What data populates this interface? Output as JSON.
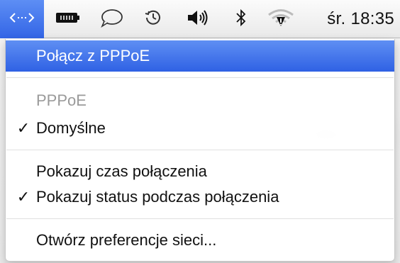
{
  "menubar": {
    "icons": [
      {
        "name": "network-ppp-icon",
        "active": true
      },
      {
        "name": "battery-icon"
      },
      {
        "name": "messages-bubble-icon"
      },
      {
        "name": "time-machine-icon"
      },
      {
        "name": "volume-icon"
      },
      {
        "name": "bluetooth-icon"
      },
      {
        "name": "wifi-alert-icon"
      }
    ],
    "clock": "śr. 18:35"
  },
  "menu": {
    "connect": "Połącz z PPPoE",
    "section_header": "PPPoE",
    "default_config": "Domyślne",
    "show_time": "Pokazuj czas połączenia",
    "show_status": "Pokazuj status podczas połączenia",
    "open_prefs": "Otwórz preferencje sieci...",
    "checkmark": "✓"
  },
  "colors": {
    "highlight": "#3365e6",
    "disabled_text": "#9a9a9a"
  }
}
